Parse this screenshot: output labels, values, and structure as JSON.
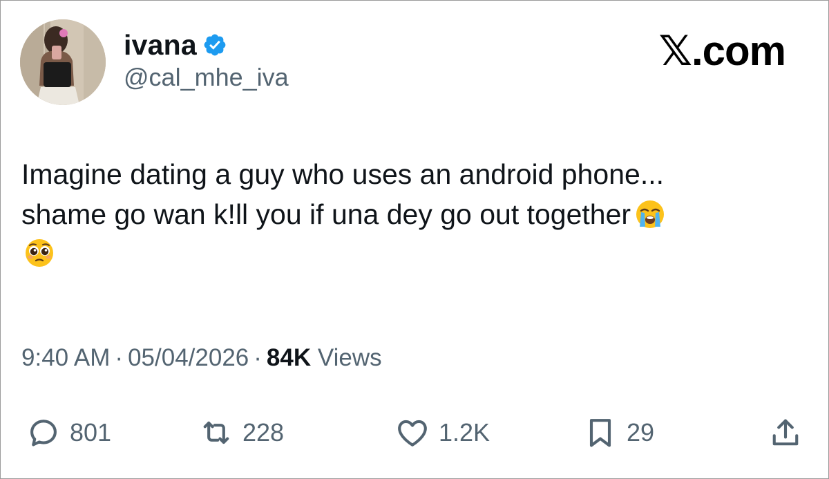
{
  "author": {
    "display_name": "ivana",
    "handle": "@cal_mhe_iva",
    "verified": true
  },
  "brand": {
    "label": "𝕏.com"
  },
  "tweet": {
    "lines": [
      "Imagine dating a guy who uses an android phone...",
      "shame go wan k!ll you if una dey go out together"
    ],
    "emojis": [
      "loudly-crying-face",
      "pleading-face"
    ]
  },
  "meta": {
    "time": "9:40 AM",
    "separator": "·",
    "date": "05/04/2026",
    "views_count": "84K",
    "views_label": "Views"
  },
  "actions": {
    "replies": "801",
    "reposts": "228",
    "likes": "1.2K",
    "bookmarks": "29"
  },
  "colors": {
    "text": "#0f1419",
    "secondary": "#536471",
    "verified_blue": "#1d9bf0"
  }
}
